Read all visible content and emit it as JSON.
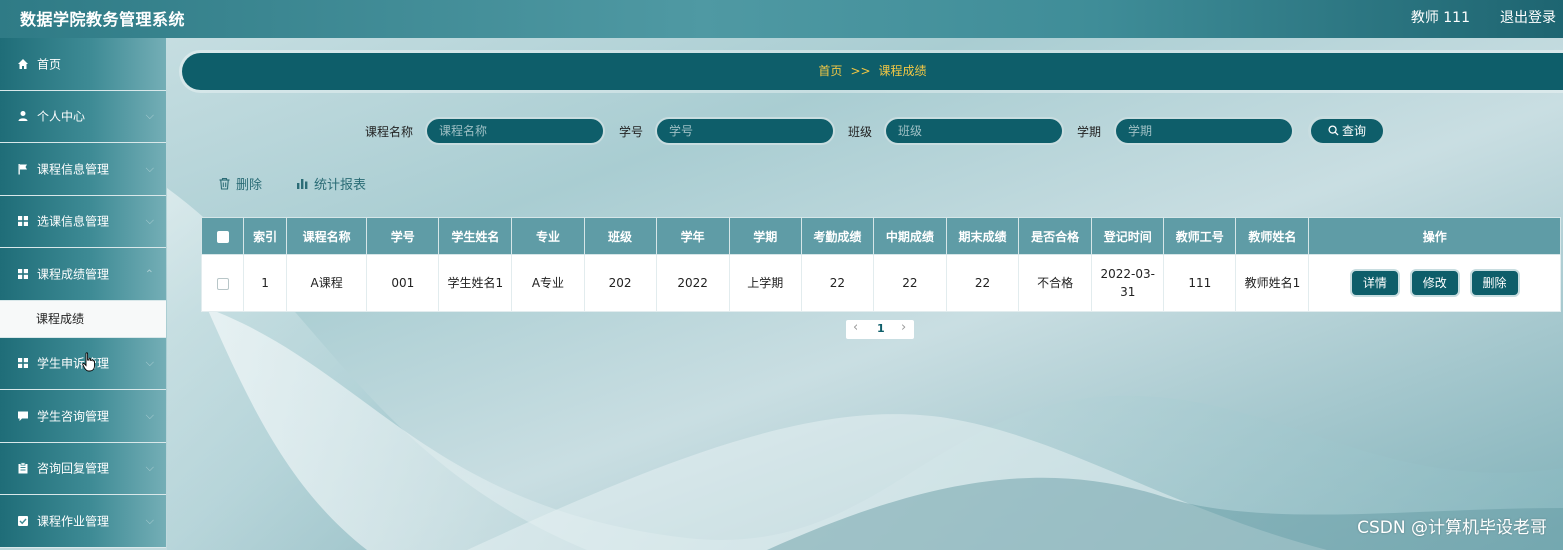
{
  "app": {
    "title": "数据学院教务管理系统",
    "user": "教师 111",
    "logout": "退出登录"
  },
  "sidebar": {
    "items": [
      {
        "label": "首页",
        "icon": "home-icon"
      },
      {
        "label": "个人中心",
        "icon": "user-icon"
      },
      {
        "label": "课程信息管理",
        "icon": "flag-icon"
      },
      {
        "label": "选课信息管理",
        "icon": "grid-icon"
      },
      {
        "label": "课程成绩管理",
        "icon": "grid-icon"
      },
      {
        "label": "学生申诉管理",
        "icon": "grid-icon"
      },
      {
        "label": "学生咨询管理",
        "icon": "chat-icon"
      },
      {
        "label": "咨询回复管理",
        "icon": "clipboard-icon"
      },
      {
        "label": "课程作业管理",
        "icon": "checkbox-icon"
      }
    ],
    "active_sub": "课程成绩"
  },
  "breadcrumb": {
    "home": "首页",
    "sep": ">>",
    "current": "课程成绩"
  },
  "search": {
    "course_label": "课程名称",
    "course_placeholder": "课程名称",
    "sno_label": "学号",
    "sno_placeholder": "学号",
    "class_label": "班级",
    "class_placeholder": "班级",
    "term_label": "学期",
    "term_placeholder": "学期",
    "query": "查询"
  },
  "toolbar": {
    "delete": "删除",
    "report": "统计报表"
  },
  "table": {
    "headers": [
      "索引",
      "课程名称",
      "学号",
      "学生姓名",
      "专业",
      "班级",
      "学年",
      "学期",
      "考勤成绩",
      "中期成绩",
      "期末成绩",
      "是否合格",
      "登记时间",
      "教师工号",
      "教师姓名",
      "操作"
    ],
    "rows": [
      {
        "index": "1",
        "course": "A课程",
        "sno": "001",
        "student": "学生姓名1",
        "major": "A专业",
        "class": "202",
        "year": "2022",
        "term": "上学期",
        "attendance": "22",
        "midterm": "22",
        "final": "22",
        "passed": "不合格",
        "date_line1": "2022-03-",
        "date_line2": "31",
        "teacher_no": "111",
        "teacher": "教师姓名1",
        "actions": {
          "detail": "详情",
          "edit": "修改",
          "delete": "删除"
        }
      }
    ]
  },
  "pager": {
    "prev": "‹",
    "page": "1",
    "next": "›"
  },
  "watermark": "CSDN @计算机毕设老哥",
  "colors": {
    "primary": "#0e5e6a",
    "header": "#5f9ca6",
    "breadcrumb_text": "#f2c744"
  }
}
